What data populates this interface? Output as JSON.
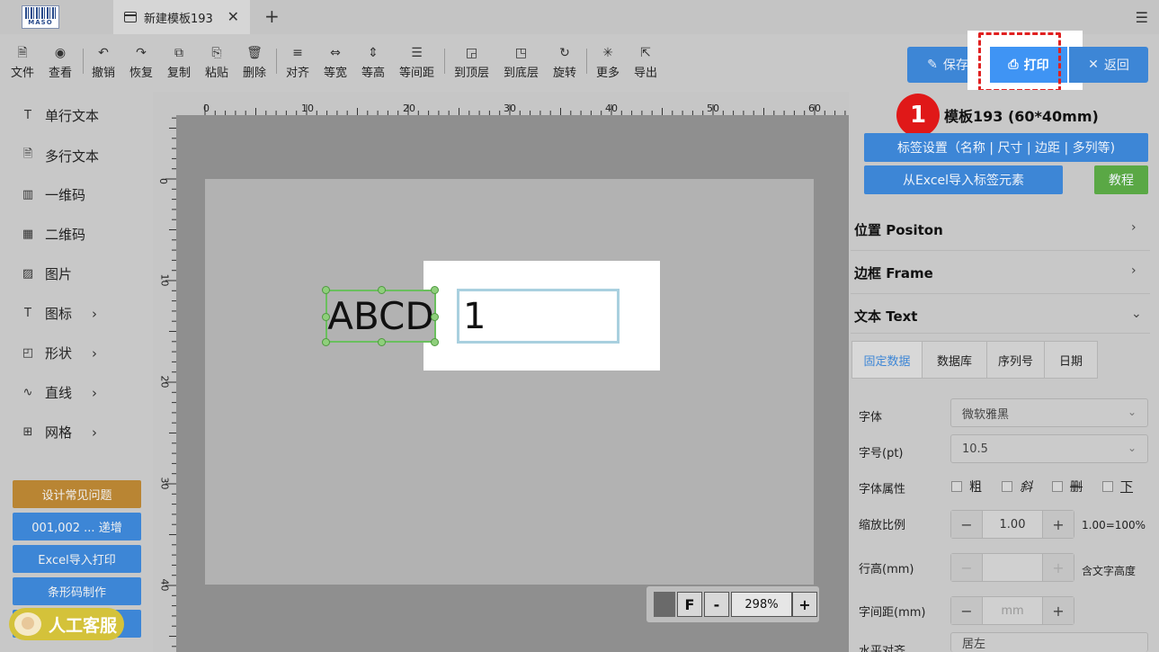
{
  "app": {
    "logo_text": "MASO"
  },
  "tabs": [
    {
      "label": "新建模板193"
    }
  ],
  "toolbar": {
    "items": [
      {
        "label": "文件",
        "icon": "file-icon"
      },
      {
        "label": "查看",
        "icon": "eye-icon"
      },
      {
        "label": "撤销",
        "icon": "undo-icon"
      },
      {
        "label": "恢复",
        "icon": "redo-icon"
      },
      {
        "label": "复制",
        "icon": "copy-icon"
      },
      {
        "label": "粘贴",
        "icon": "paste-icon"
      },
      {
        "label": "删除",
        "icon": "trash-icon"
      },
      {
        "label": "对齐",
        "icon": "align-icon"
      },
      {
        "label": "等宽",
        "icon": "equal-width-icon"
      },
      {
        "label": "等高",
        "icon": "equal-height-icon"
      },
      {
        "label": "等间距",
        "icon": "equal-spacing-icon"
      },
      {
        "label": "到顶层",
        "icon": "bring-front-icon"
      },
      {
        "label": "到底层",
        "icon": "send-back-icon"
      },
      {
        "label": "旋转",
        "icon": "rotate-icon"
      },
      {
        "label": "更多",
        "icon": "more-icon"
      },
      {
        "label": "导出",
        "icon": "export-icon"
      }
    ],
    "save_label": "保存",
    "print_label": "打印",
    "back_label": "返回"
  },
  "left_panel": {
    "items": [
      {
        "label": "单行文本",
        "icon": "text-icon",
        "submenu": false
      },
      {
        "label": "多行文本",
        "icon": "multiline-text-icon",
        "submenu": false
      },
      {
        "label": "一维码",
        "icon": "barcode-icon",
        "submenu": false
      },
      {
        "label": "二维码",
        "icon": "qrcode-icon",
        "submenu": false
      },
      {
        "label": "图片",
        "icon": "image-icon",
        "submenu": false
      },
      {
        "label": "图标",
        "icon": "icon-icon",
        "submenu": true
      },
      {
        "label": "形状",
        "icon": "shape-icon",
        "submenu": true
      },
      {
        "label": "直线",
        "icon": "line-icon",
        "submenu": true
      },
      {
        "label": "网格",
        "icon": "grid-icon",
        "submenu": true
      }
    ],
    "buttons": [
      {
        "label": "设计常见问题",
        "color": "#b98533"
      },
      {
        "label": "001,002 ... 递增",
        "color": "#3d86d6"
      },
      {
        "label": "Excel导入打印",
        "color": "#3d86d6"
      },
      {
        "label": "条形码制作",
        "color": "#3d86d6"
      }
    ],
    "support_label": "人工客服"
  },
  "canvas": {
    "ruler_x": [
      "0",
      "10",
      "20",
      "30",
      "40",
      "50",
      "60"
    ],
    "ruler_y": [
      "0",
      "10",
      "20",
      "30",
      "40"
    ],
    "elements": {
      "text1": "ABCD",
      "text2": "1"
    },
    "zoom": {
      "f_label": "F",
      "minus": "-",
      "value": "298%",
      "plus": "+"
    }
  },
  "right_panel": {
    "step_badge": "1",
    "template_title": "模板193 (60*40mm)",
    "label_settings": "标签设置（名称 | 尺寸 | 边距 | 多列等)",
    "excel_import": "从Excel导入标签元素",
    "tutorial": "教程",
    "sections": [
      {
        "label": "位置 Positon",
        "expanded": false
      },
      {
        "label": "边框 Frame",
        "expanded": false
      },
      {
        "label": "文本 Text",
        "expanded": true
      }
    ],
    "subtabs": [
      {
        "label": "固定数据",
        "active": true
      },
      {
        "label": "数据库",
        "active": false
      },
      {
        "label": "序列号",
        "active": false
      },
      {
        "label": "日期",
        "active": false
      }
    ],
    "font_label": "字体",
    "font_value": "微软雅黑",
    "size_label": "字号(pt)",
    "size_value": "10.5",
    "attr_label": "字体属性",
    "attrs": [
      "粗",
      "斜",
      "删",
      "下"
    ],
    "scale_label": "缩放比例",
    "scale_value": "1.00",
    "scale_note": "1.00=100%",
    "line_height_label": "行高(mm)",
    "line_height_note": "含文字高度",
    "spacing_label": "字间距(mm)",
    "spacing_placeholder": "mm",
    "halign_label": "水平对齐",
    "halign_value": "居左"
  },
  "colors": {
    "accent": "#3d86d6",
    "print": "#3f94f4",
    "danger": "#e01818",
    "tutorial": "#5aa845"
  }
}
